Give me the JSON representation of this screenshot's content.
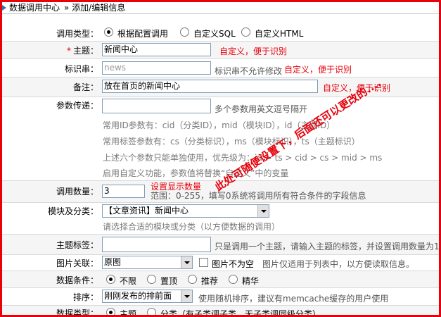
{
  "breadcrumb": {
    "section": "数据调用中心",
    "current": "» 添加/编辑信息"
  },
  "form": {
    "call_type": {
      "label": "调用类型：",
      "options": [
        "根据配置调用",
        "自定义SQL",
        "自定义HTML"
      ],
      "selected": 0
    },
    "subject": {
      "label": "主题：",
      "required_mark": "*",
      "value": "新闻中心",
      "hint": "自定义，便于识别"
    },
    "tag": {
      "label": "标识串：",
      "placeholder": "news",
      "note": "标识串不允许修改",
      "hint": "自定义，便于识别"
    },
    "remark": {
      "label": "备注：",
      "value": "放在首页的新闻中心",
      "hint": "自定义，便于识别"
    },
    "params": {
      "label": "参数传递：",
      "value": "",
      "note": "多个参数用英文逗号隔开",
      "lines": [
        "常用ID参数有：cid（分类ID），mid（模块ID），id（主题ID）",
        "常用标签参数有：cs（分类标识），ms（模块标识），ts（主题标识）",
        "上述六个参数只能单独使用，优先级为：id > ts > cid > cs > mid > ms",
        "启用自定义功能，参数值将替换“自定义”中的变量"
      ]
    },
    "count": {
      "label": "调用数量：",
      "value": "3",
      "hint": "设置显示数量",
      "note": "范围：0-255，填写0系统将调用所有符合条件的字段信息"
    },
    "module": {
      "label": "模块及分类：",
      "value": "【文章资讯】新闻中心",
      "note": "请选择合适的模块或分类（以方便数据的调用）"
    },
    "topic_tag": {
      "label": "主题标签：",
      "value": "",
      "note": "只是调用一个主题，请输入主题的标签，并设置调用数量为1"
    },
    "image": {
      "label": "图片关联：",
      "value": "原图",
      "checkbox_label": "图片不为空",
      "note": "图片仅适用于列表中，以方便读取信息。"
    },
    "condition": {
      "label": "数据条件：",
      "options": [
        "不限",
        "置顶",
        "推荐",
        "精华"
      ],
      "selected": 0
    },
    "sort": {
      "label": "排序：",
      "value": "刚刚发布的排前面",
      "note": "使用随机排序，建议有memcache缓存的用户使用"
    },
    "data_type": {
      "label": "数据类型：",
      "options": [
        "主题",
        "分类（有子类调子类，无子类调同级分类）"
      ],
      "selected": 0
    }
  },
  "annotation": {
    "text": "此处可随便设置下，后面还可以更改的....",
    "color": "#e8000b"
  }
}
